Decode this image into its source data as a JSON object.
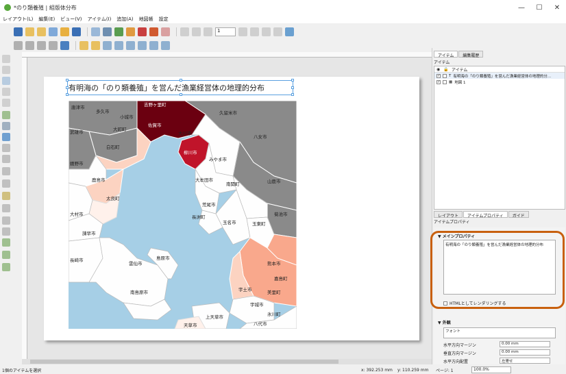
{
  "window": {
    "title": "*のり類養殖 | 組版体分布",
    "minimize": "—",
    "maximize": "☐",
    "close": "✕"
  },
  "menu": [
    "レイアウト(L)",
    "編集(E)",
    "ビュー(V)",
    "アイテム(I)",
    "追加(A)",
    "地図帳",
    "設定"
  ],
  "toolbar": {
    "page_number": "1"
  },
  "map": {
    "title": "有明海の「のり類養殖」を営んだ漁業経営体の地理的分布",
    "labels": {
      "karatsu": "唐津市",
      "taku": "多久市",
      "ogi": "小城市",
      "yoshinogari": "吉野ヶ里町",
      "kurume": "久留米市",
      "saga": "佐賀市",
      "takeo": "武雄市",
      "okawa": "大川市",
      "omachi": "大町町",
      "yame": "八女市",
      "shiroishi": "白石町",
      "yanagawa": "柳川市",
      "ureshino": "嬉野市",
      "miyama": "みやま市",
      "kashima": "鹿島市",
      "omuta": "大牟田市",
      "nankan": "南関町",
      "yamaga": "山鹿市",
      "tara": "太良町",
      "arao": "荒尾市",
      "nagasu": "長洲町",
      "omura": "大村市",
      "tamana": "玉名市",
      "kikuchi": "菊池市",
      "isahaya": "諫早市",
      "gyokuto": "玉東町",
      "nagasaki": "長崎市",
      "unzen": "雲仙市",
      "shimabara": "島原市",
      "kumamoto": "熊本市",
      "uto": "宇土市",
      "minamishimabara": "南島原市",
      "uki": "宇城市",
      "yatsushiro": "八代市",
      "amakusa": "天草市",
      "hikawa": "氷川町",
      "kamiamakusa": "上天草市",
      "misato": "美里町",
      "kashima2": "嘉島町"
    }
  },
  "statusbar": {
    "selection": "1個のアイテムを選択",
    "x": "x: 392.253 mm",
    "y": "y: 110.259 mm",
    "page": "ページ: 1",
    "zoom": "100.0%"
  },
  "panel_top": {
    "tabs": [
      "アイテム",
      "編集履歴"
    ],
    "title": "アイテム",
    "header_item": "アイテム",
    "items": [
      {
        "label": "有明海の「のり類養殖」を営んだ漁業経営体の地理的分...",
        "type": "T"
      },
      {
        "label": "地図 1",
        "type": "map"
      }
    ]
  },
  "panel_bottom": {
    "tabs": [
      "レイアウト",
      "アイテムプロパティ",
      "ガイド"
    ],
    "title": "アイテムプロパティ",
    "main_section": "メインプロパティ",
    "label_text": "有明海の「のり類養殖」を営んだ漁業経営体の地理的分布",
    "html_checkbox": "HTMLとしてレンダリングする",
    "appearance_section": "外観",
    "font_label": "フォント",
    "h_margin_label": "水平方向マージン",
    "h_margin_value": "0.00 mm",
    "v_margin_label": "垂直方向マージン",
    "v_margin_value": "0.00 mm",
    "h_align_label": "水平方向配置",
    "h_align_value": "左寄せ"
  },
  "colors": {
    "sea": "#a6cfe6",
    "gray_region": "#8a8a8a",
    "dark_red": "#6b0010",
    "red": "#c0142a",
    "salmon": "#f9a88c",
    "light_pink": "#fcd3c1",
    "pale": "#fff1eb",
    "white_region": "#fefefe",
    "highlight": "#c8600e"
  }
}
